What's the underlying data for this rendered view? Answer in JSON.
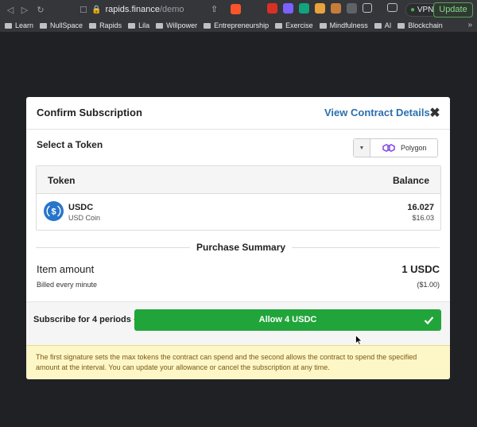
{
  "browser": {
    "url_host": "rapids.finance",
    "url_path": "/demo",
    "vpn_label": "VPN",
    "update_label": "Update",
    "extension_colors": [
      "#d93025",
      "#7b61ff",
      "#12a37f",
      "#e8a33d",
      "#c77d3a",
      "#5f6368"
    ],
    "bookmarks": [
      "Learn",
      "NullSpace",
      "Rapids",
      "Lila",
      "Willpower",
      "Entrepreneurship",
      "Exercise",
      "Mindfulness",
      "AI",
      "Blockchain"
    ]
  },
  "modal": {
    "title": "Confirm Subscription",
    "contract_link": "View Contract Details",
    "select_token_label": "Select a Token",
    "network": "Polygon",
    "table": {
      "headers": {
        "token": "Token",
        "balance": "Balance"
      },
      "rows": [
        {
          "symbol": "USDC",
          "name": "USD Coin",
          "balance": "16.027",
          "value": "$16.03"
        }
      ]
    },
    "summary": {
      "title": "Purchase Summary",
      "item_label": "Item amount",
      "item_amount": "1 USDC",
      "billed_label": "Billed every minute",
      "billed_amount": "($1.00)"
    },
    "actions": {
      "periods_label": "Subscribe for 4 periods",
      "allow_label": "Allow 4 USDC"
    },
    "notice": "The first signature sets the max tokens the contract can spend and the second allows the contract to spend the specified amount at the interval. You can update your allowance or cancel the subscription at any time."
  },
  "colors": {
    "accent_link": "#2b6fb0",
    "allow_green": "#21a53b",
    "usdc_blue": "#2775ca",
    "polygon_purple": "#8247e5",
    "notice_bg": "#fdf6c7",
    "notice_text": "#7a5a13"
  }
}
